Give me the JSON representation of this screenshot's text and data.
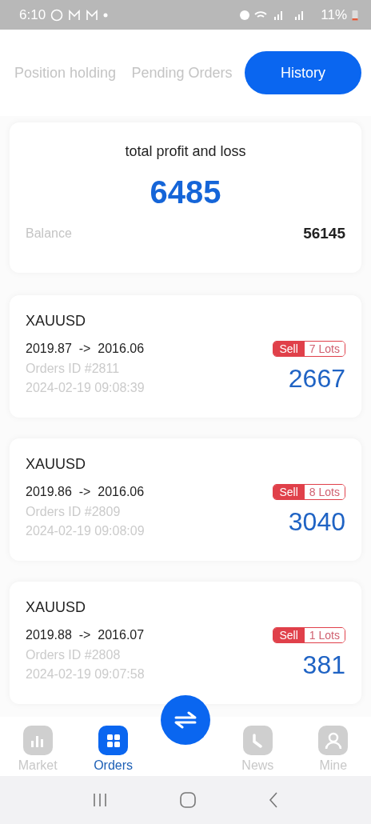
{
  "status_bar": {
    "time": "6:10",
    "battery": "11%"
  },
  "tabs": [
    {
      "label": "Position holding",
      "selected": false
    },
    {
      "label": "Pending Orders",
      "selected": false
    },
    {
      "label": "History",
      "selected": true
    }
  ],
  "summary": {
    "title": "total profit and loss",
    "total": "6485",
    "balance_label": "Balance",
    "balance": "56145"
  },
  "orders": [
    {
      "symbol": "XAUUSD",
      "open_price": "2019.87",
      "arrow": "->",
      "close_price": "2016.06",
      "order_id": "Orders ID #2811",
      "time": "2024-02-19 09:08:39",
      "side": "Sell",
      "lots": "7 Lots",
      "profit": "2667"
    },
    {
      "symbol": "XAUUSD",
      "open_price": "2019.86",
      "arrow": "->",
      "close_price": "2016.06",
      "order_id": "Orders ID #2809",
      "time": "2024-02-19 09:08:09",
      "side": "Sell",
      "lots": "8 Lots",
      "profit": "3040"
    },
    {
      "symbol": "XAUUSD",
      "open_price": "2019.88",
      "arrow": "->",
      "close_price": "2016.07",
      "order_id": "Orders ID #2808",
      "time": "2024-02-19 09:07:58",
      "side": "Sell",
      "lots": "1 Lots",
      "profit": "381"
    }
  ],
  "bottom_nav": [
    {
      "kind": "chart",
      "label": "Market",
      "selected": false
    },
    {
      "kind": "grid",
      "label": "Orders",
      "selected": true
    },
    {
      "kind": "fab"
    },
    {
      "kind": "clock",
      "label": "News",
      "selected": false
    },
    {
      "kind": "person",
      "label": "Mine",
      "selected": false
    }
  ]
}
